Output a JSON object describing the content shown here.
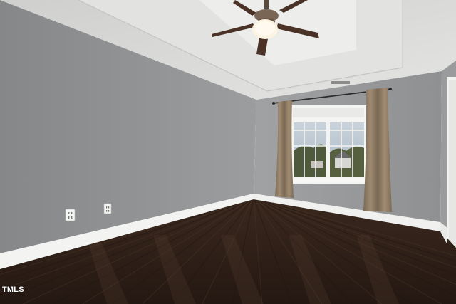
{
  "watermark": {
    "text": "TMLS"
  },
  "colors": {
    "wall_left": "#8d8f91",
    "wall_back": "#97989a",
    "ceiling": "#d9d9d7",
    "tray": "#ececea",
    "baseboard": "#f3f3f1",
    "floor_dark": "#2e1f17",
    "floor_light": "#5a4234",
    "curtain": "#8c7862",
    "window_frame": "#f4f4f2",
    "fan_blade": "#4a3326"
  },
  "icons": [
    "ceiling-fan-icon",
    "outlet-icon",
    "curtain-rod-icon"
  ]
}
